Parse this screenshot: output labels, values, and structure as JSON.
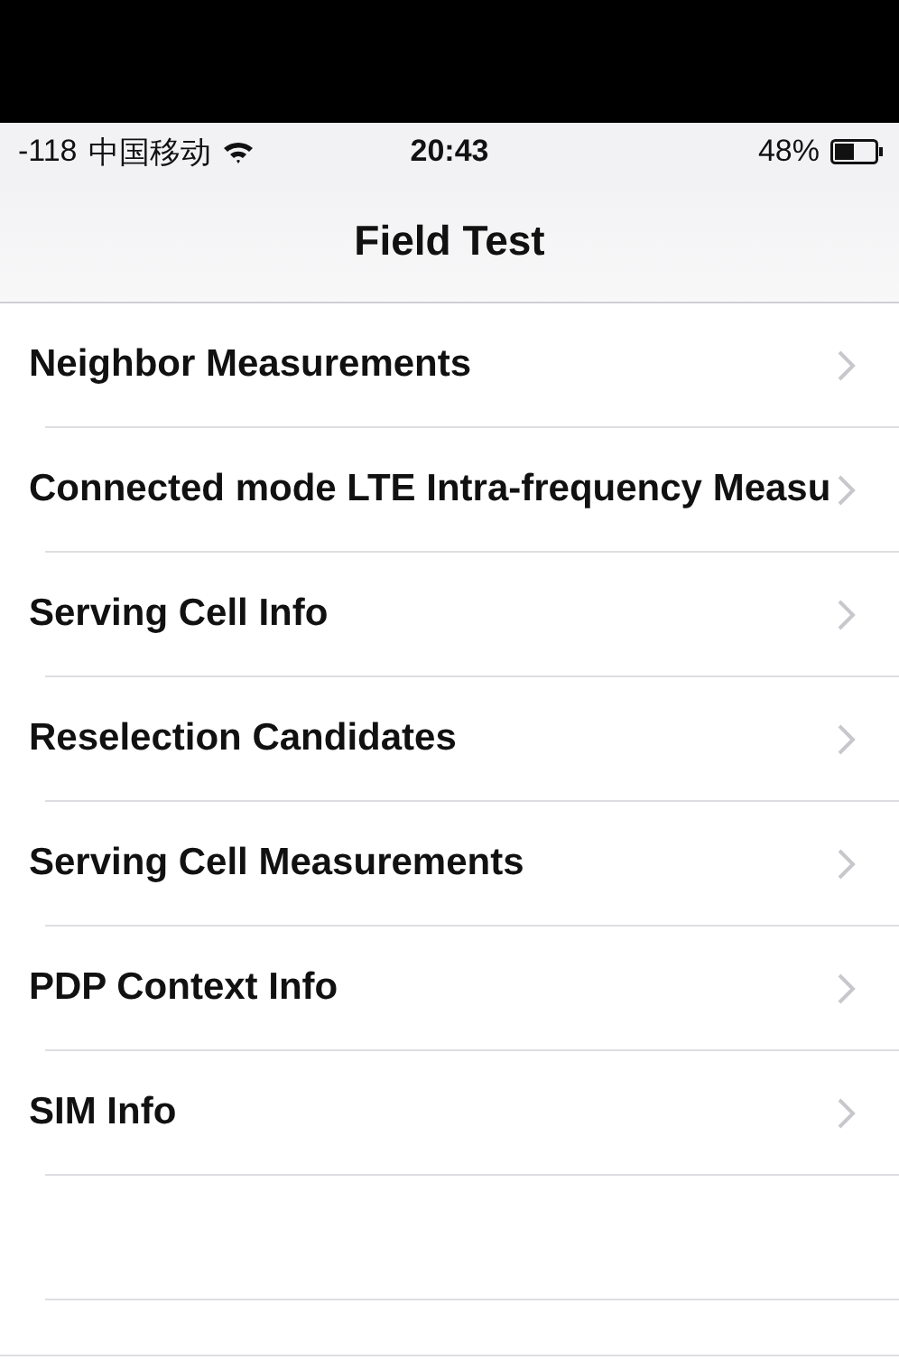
{
  "status_bar": {
    "signal": "-118",
    "carrier": "中国移动",
    "time": "20:43",
    "battery": "48%"
  },
  "nav_bar": {
    "title": "Field Test"
  },
  "items": [
    {
      "label": "Neighbor Measurements"
    },
    {
      "label": "Connected mode LTE Intra-frequency Measu"
    },
    {
      "label": "Serving Cell Info"
    },
    {
      "label": "Reselection Candidates"
    },
    {
      "label": "Serving Cell Measurements"
    },
    {
      "label": "PDP Context Info"
    },
    {
      "label": "SIM Info"
    }
  ]
}
